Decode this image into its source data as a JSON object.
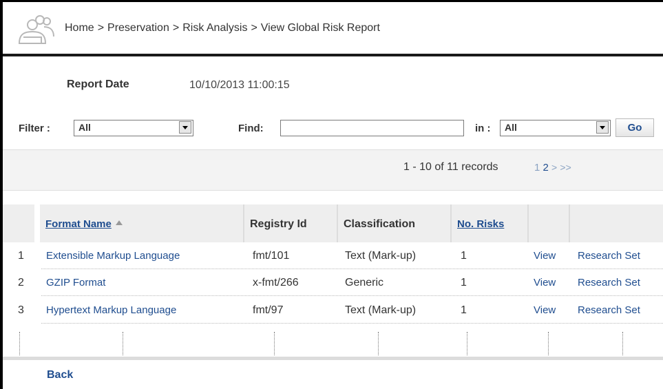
{
  "breadcrumb": {
    "items": [
      "Home",
      "Preservation",
      "Risk Analysis",
      "View Global Risk Report"
    ],
    "separator": ">"
  },
  "report": {
    "date_label": "Report Date",
    "date_value": "10/10/2013 11:00:15"
  },
  "filters": {
    "filter_label": "Filter :",
    "filter_value": "All",
    "find_label": "Find:",
    "find_value": "",
    "in_label": "in :",
    "in_value": "All",
    "go_label": "Go"
  },
  "pager": {
    "records_text": "1 - 10 of 11 records",
    "current_page": "1",
    "next_page": "2",
    "next_symbol": ">",
    "last_symbol": ">>"
  },
  "table": {
    "headers": [
      "Format Name",
      "Registry Id",
      "Classification",
      "No. Risks"
    ],
    "rows": [
      {
        "index": "1",
        "format": "Extensible Markup Language",
        "registry": "fmt/101",
        "classification": "Text (Mark-up)",
        "risks": "1",
        "view": "View",
        "research": "Research Set"
      },
      {
        "index": "2",
        "format": "GZIP Format",
        "registry": "x-fmt/266",
        "classification": "Generic",
        "risks": "1",
        "view": "View",
        "research": "Research Set"
      },
      {
        "index": "3",
        "format": "Hypertext Markup Language",
        "registry": "fmt/97",
        "classification": "Text (Mark-up)",
        "risks": "1",
        "view": "View",
        "research": "Research Set"
      }
    ]
  },
  "footer": {
    "back_label": "Back"
  },
  "colors": {
    "link": "#1f4d8f",
    "header_bg": "#eeeeee",
    "pager_bg": "#f3f3f3"
  }
}
